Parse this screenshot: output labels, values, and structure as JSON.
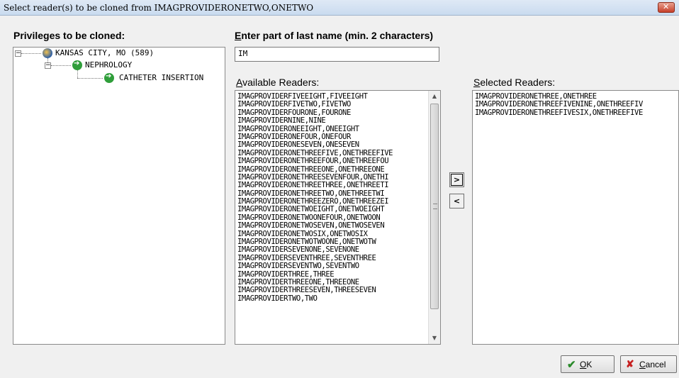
{
  "window": {
    "title": "Select reader(s) to be cloned from IMAGPROVIDERONETWO,ONETWO"
  },
  "privileges": {
    "label": "Privileges to be cloned:",
    "tree": [
      {
        "label": "KANSAS CITY, MO (589)",
        "icon": "globe-icon",
        "expanded": true
      },
      {
        "label": "NEPHROLOGY",
        "icon": "green-arrow-icon",
        "expanded": true
      },
      {
        "label": "CATHETER INSERTION",
        "icon": "green-arrow-icon"
      }
    ]
  },
  "search": {
    "label_underlined": "E",
    "label_rest": "nter part of last name (min. 2 characters)",
    "value": "IM"
  },
  "available": {
    "label_underlined": "A",
    "label_rest": "vailable Readers:",
    "items": [
      "IMAGPROVIDERFIVEEIGHT,FIVEEIGHT",
      "IMAGPROVIDERFIVETWO,FIVETWO",
      "IMAGPROVIDERFOURONE,FOURONE",
      "IMAGPROVIDERNINE,NINE",
      "IMAGPROVIDERONEEIGHT,ONEEIGHT",
      "IMAGPROVIDERONEFOUR,ONEFOUR",
      "IMAGPROVIDERONESEVEN,ONESEVEN",
      "IMAGPROVIDERONETHREEFIVE,ONETHREEFIVE",
      "IMAGPROVIDERONETHREEFOUR,ONETHREEFOU",
      "IMAGPROVIDERONETHREEONE,ONETHREEONE",
      "IMAGPROVIDERONETHREESEVENFOUR,ONETHI",
      "IMAGPROVIDERONETHREETHREE,ONETHREETI",
      "IMAGPROVIDERONETHREETWO,ONETHREETWI",
      "IMAGPROVIDERONETHREEZERO,ONETHREEZEI",
      "IMAGPROVIDERONETWOEIGHT,ONETWOEIGHT",
      "IMAGPROVIDERONETWOONEFOUR,ONETWOON",
      "IMAGPROVIDERONETWOSEVEN,ONETWOSEVEN",
      "IMAGPROVIDERONETWOSIX,ONETWOSIX",
      "IMAGPROVIDERONETWOTWOONE,ONETWOTW",
      "IMAGPROVIDERSEVENONE,SEVENONE",
      "IMAGPROVIDERSEVENTHREE,SEVENTHREE",
      "IMAGPROVIDERSEVENTWO,SEVENTWO",
      "IMAGPROVIDERTHREE,THREE",
      "IMAGPROVIDERTHREEONE,THREEONE",
      "IMAGPROVIDERTHREESEVEN,THREESEVEN",
      "IMAGPROVIDERTWO,TWO"
    ]
  },
  "transfer": {
    "add_label": ">",
    "remove_label": "<"
  },
  "selected": {
    "label_underlined": "S",
    "label_rest": "elected Readers:",
    "items": [
      "IMAGPROVIDERONETHREE,ONETHREE",
      "IMAGPROVIDERONETHREEFIVENINE,ONETHREEFIV",
      "IMAGPROVIDERONETHREEFIVESIX,ONETHREEFIVE"
    ]
  },
  "buttons": {
    "ok_underlined": "O",
    "ok_rest": "K",
    "cancel_underlined": "C",
    "cancel_rest": "ancel"
  }
}
